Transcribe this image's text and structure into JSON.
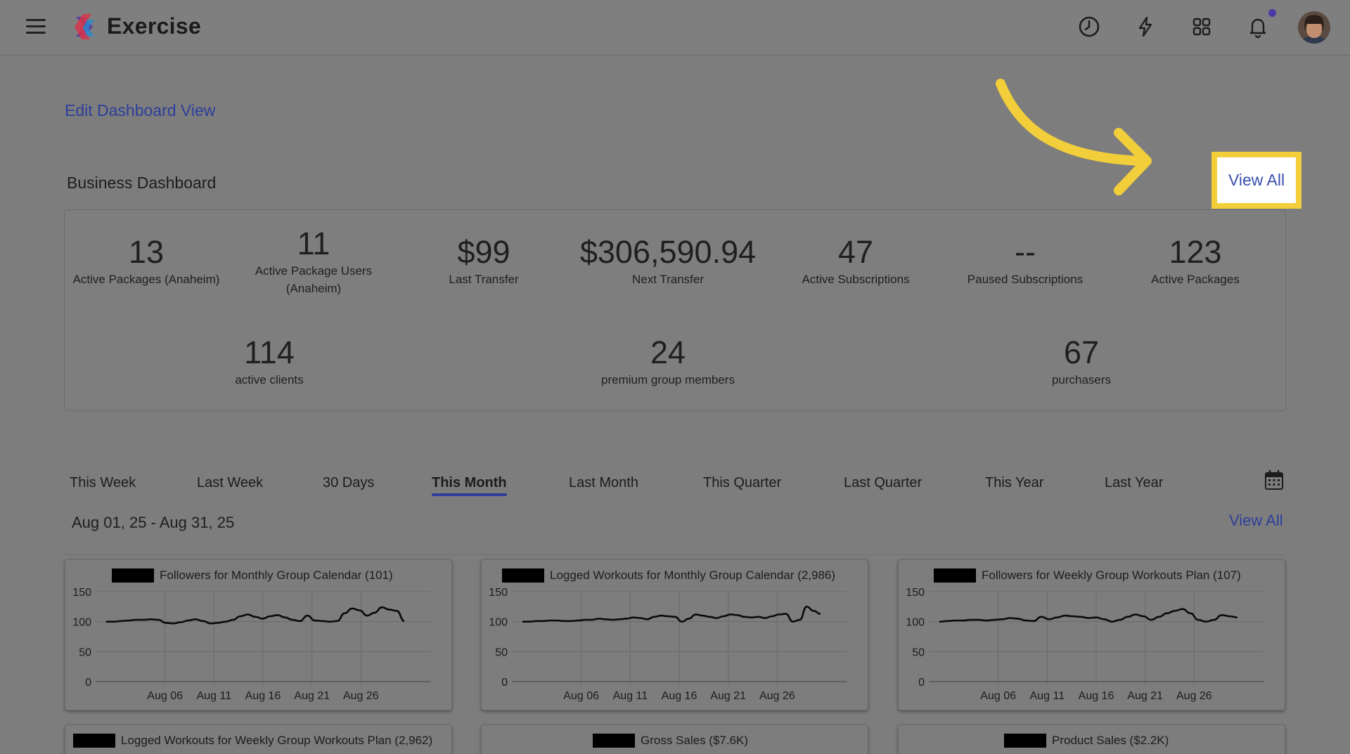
{
  "header": {
    "brand": "Exercise",
    "icons": [
      "clock-icon",
      "lightning-icon",
      "apps-grid-icon",
      "bell-icon"
    ],
    "accent": "#2c3e9a",
    "highlight": "#f2cf3a"
  },
  "page": {
    "edit_link": "Edit Dashboard View",
    "section_title": "Business Dashboard",
    "view_all_top": "View All"
  },
  "stats": {
    "row1": [
      {
        "value": "13",
        "label": "Active Packages (Anaheim)"
      },
      {
        "value": "11",
        "label": "Active Package Users (Anaheim)"
      },
      {
        "value": "$99",
        "label": "Last Transfer"
      },
      {
        "value": "$306,590.94",
        "label": "Next Transfer"
      },
      {
        "value": "47",
        "label": "Active Subscriptions"
      },
      {
        "value": "--",
        "label": "Paused Subscriptions"
      },
      {
        "value": "123",
        "label": "Active Packages"
      }
    ],
    "row2": [
      {
        "value": "114",
        "label": "active clients"
      },
      {
        "value": "24",
        "label": "premium group members"
      },
      {
        "value": "67",
        "label": "purchasers"
      }
    ]
  },
  "periods": {
    "tabs": [
      "This Week",
      "Last Week",
      "30 Days",
      "This Month",
      "Last Month",
      "This Quarter",
      "Last Quarter",
      "This Year",
      "Last Year"
    ],
    "active": "This Month",
    "date_range": "Aug 01, 25 - Aug 31, 25",
    "view_all": "View All"
  },
  "chart_data": [
    {
      "type": "line",
      "series": [
        {
          "name": "Followers for Monthly Group Calendar (101)",
          "values": [
            100,
            100,
            101,
            102,
            103,
            103,
            104,
            103,
            98,
            97,
            99,
            102,
            104,
            101,
            97,
            98,
            100,
            103,
            109,
            112,
            108,
            105,
            109,
            111,
            107,
            103,
            101,
            110,
            102,
            101,
            100,
            101,
            114,
            122,
            119,
            110,
            115,
            124,
            120,
            118,
            101
          ]
        }
      ],
      "yticks": [
        "150",
        "100",
        "50",
        "0"
      ],
      "ylim": [
        0,
        150
      ],
      "xticks": [
        "Aug 06",
        "Aug 11",
        "Aug 16",
        "Aug 21",
        "Aug 26"
      ]
    },
    {
      "type": "line",
      "series": [
        {
          "name": "Logged Workouts for Monthly Group Calendar (2,986)",
          "values": [
            100,
            100,
            101,
            101,
            102,
            102,
            101,
            101,
            102,
            103,
            103,
            105,
            104,
            103,
            104,
            105,
            107,
            106,
            104,
            108,
            110,
            109,
            108,
            100,
            105,
            112,
            110,
            108,
            106,
            109,
            112,
            111,
            108,
            107,
            108,
            106,
            109,
            112,
            113,
            100,
            103,
            125,
            118,
            113
          ]
        }
      ],
      "yticks": [
        "150",
        "100",
        "50",
        "0"
      ],
      "ylim": [
        0,
        150
      ],
      "xticks": [
        "Aug 06",
        "Aug 11",
        "Aug 16",
        "Aug 21",
        "Aug 26"
      ]
    },
    {
      "type": "line",
      "series": [
        {
          "name": "Followers for Weekly Group Workouts Plan (107)",
          "values": [
            100,
            101,
            102,
            102,
            103,
            103,
            102,
            103,
            104,
            106,
            105,
            102,
            101,
            108,
            104,
            107,
            110,
            109,
            108,
            106,
            107,
            104,
            100,
            103,
            108,
            112,
            109,
            103,
            108,
            114,
            118,
            121,
            114,
            103,
            100,
            103,
            111,
            109,
            107
          ]
        }
      ],
      "yticks": [
        "150",
        "100",
        "50",
        "0"
      ],
      "ylim": [
        0,
        150
      ],
      "xticks": [
        "Aug 06",
        "Aug 11",
        "Aug 16",
        "Aug 21",
        "Aug 26"
      ]
    },
    {
      "type": "line",
      "series": [
        {
          "name": "Logged Workouts for Weekly Group Workouts Plan (2,962)",
          "values": []
        }
      ]
    },
    {
      "type": "line",
      "series": [
        {
          "name": "Gross Sales ($7.6K)",
          "values": []
        }
      ]
    },
    {
      "type": "line",
      "series": [
        {
          "name": "Product Sales ($2.2K)",
          "values": []
        }
      ]
    }
  ]
}
